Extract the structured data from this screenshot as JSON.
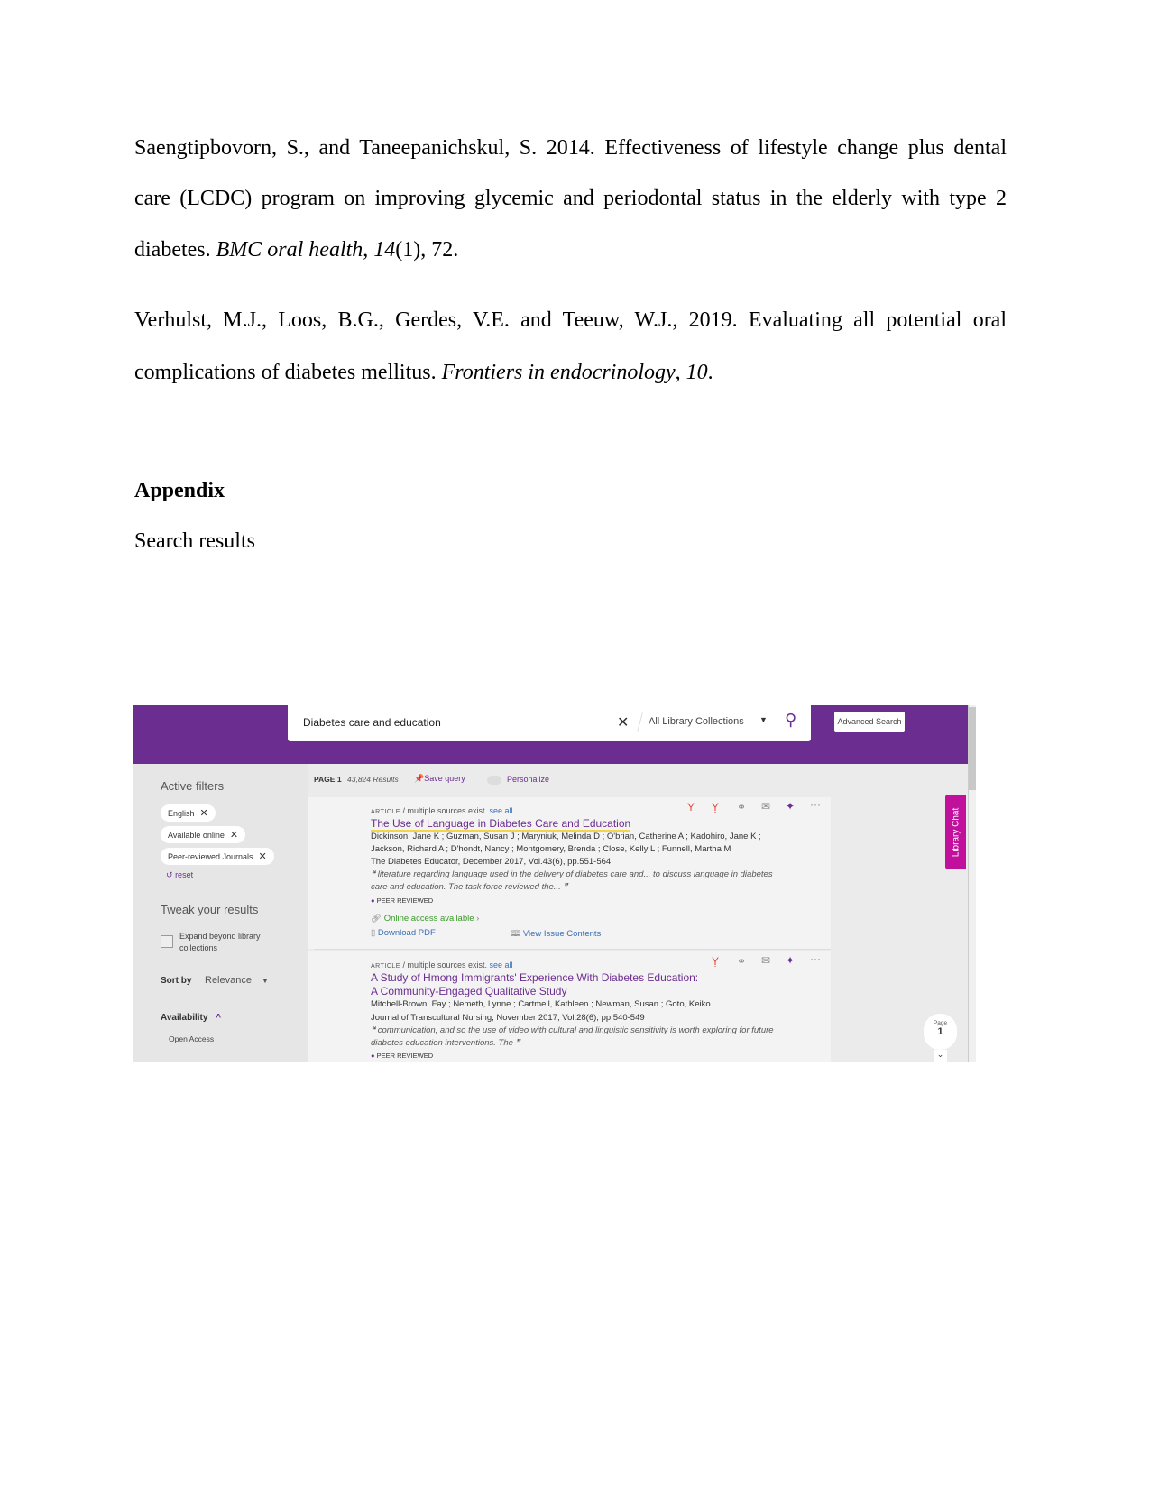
{
  "references": [
    {
      "lines": [
        "Saengtipbovorn, S., and  Taneepanichskul, S. 2014. Effectiveness of lifestyle change plus dental",
        "care (LCDC) program on improving glycemic and periodontal status in the elderly with type 2"
      ],
      "last_pre": "diabetes. ",
      "journal": "BMC oral health",
      "sep": ", ",
      "volume": "14",
      "rest": "(1), 72."
    },
    {
      "lines": [
        "Verhulst, M.J., Loos, B.G., Gerdes, V.E. and Teeuw, W.J., 2019. Evaluating all potential oral"
      ],
      "last_pre": "complications of diabetes mellitus. ",
      "journal": "Frontiers in endocrinology",
      "sep": ", ",
      "volume": "10",
      "rest": "."
    }
  ],
  "appendix": {
    "heading": "Appendix",
    "caption": "Search results"
  },
  "screenshot": {
    "search": {
      "query": "Diabetes care and education",
      "scope": "All Library Collections",
      "advanced": "Advanced Search"
    },
    "sidebar": {
      "active_filters": "Active filters",
      "chips": [
        "English",
        "Available online",
        "Peer-reviewed Journals"
      ],
      "reset": "reset",
      "tweak": "Tweak your results",
      "expand": [
        "Expand beyond library",
        "collections"
      ],
      "sort_label": "Sort by",
      "sort_value": "Relevance",
      "availability": "Availability",
      "open_access": "Open Access"
    },
    "results_bar": {
      "page": "PAGE 1",
      "count": "43,824 Results",
      "save": "Save query",
      "personalize": "Personalize"
    },
    "results": [
      {
        "type": "ARTICLE",
        "sources": "/ multiple sources exist.",
        "see_all": "see all",
        "title": [
          "The Use of Language in Diabetes Care and Education"
        ],
        "authors": [
          "Dickinson, Jane K ; Guzman, Susan J ; Maryniuk, Melinda D ; O'brian, Catherine A ; Kadohiro, Jane K ;",
          "Jackson, Richard A ; D'hondt, Nancy ; Montgomery, Brenda ; Close, Kelly L ; Funnell, Martha M"
        ],
        "journal": "The Diabetes Educator, December 2017, Vol.43(6), pp.551-564",
        "snippet": [
          "❝ literature regarding language used in the delivery of diabetes care and... to discuss language in diabetes",
          "care and education. The task force reviewed the... ❞"
        ],
        "peer": "PEER REVIEWED",
        "online": "Online access available",
        "pdf": "Download PDF",
        "issue": "View Issue Contents"
      },
      {
        "type": "ARTICLE",
        "sources": "/ multiple sources exist.",
        "see_all": "see all",
        "title": [
          "A Study of Hmong Immigrants' Experience With Diabetes Education:",
          "A Community-Engaged Qualitative Study"
        ],
        "authors": [
          "Mitchell-Brown, Fay ; Nemeth, Lynne ; Cartmell, Kathleen ; Newman, Susan ; Goto, Keiko"
        ],
        "journal": "Journal of Transcultural Nursing, November 2017, Vol.28(6), pp.540-549",
        "snippet": [
          "❝ communication, and so the use of video with cultural and linguistic sensitivity is worth exploring for future",
          "diabetes education interventions. The ❞"
        ],
        "peer": "PEER REVIEWED"
      }
    ],
    "library_chat": "Library Chat",
    "page_bubble": {
      "label": "Page",
      "number": "1"
    },
    "colors": {
      "brand": "#6b2d8f",
      "chat": "#c0109c",
      "highlight": "#f3d54a",
      "online": "#3a9a2a"
    }
  }
}
